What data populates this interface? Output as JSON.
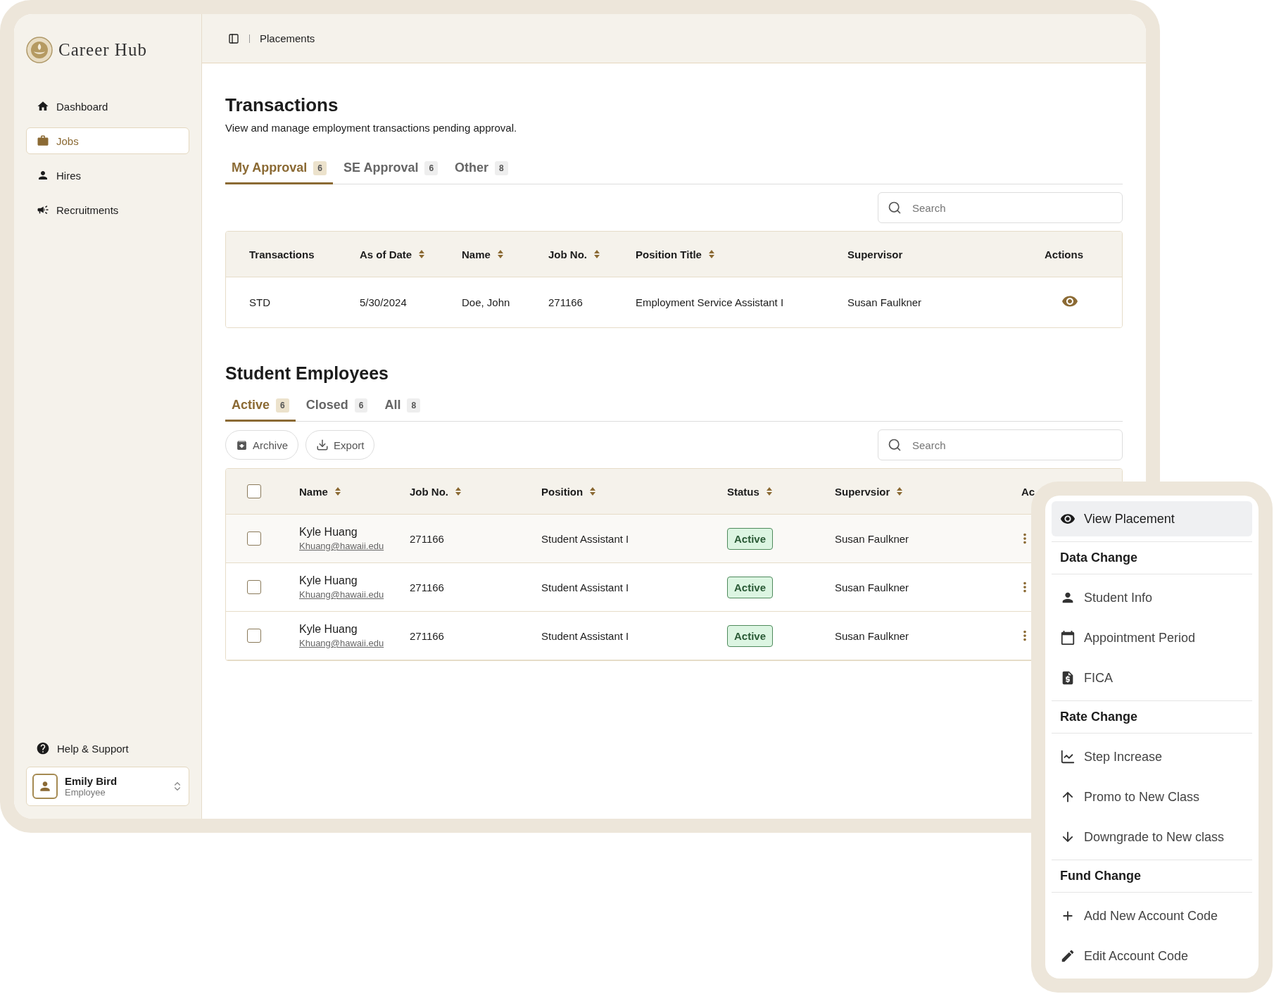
{
  "sidebar": {
    "logo": "Career Hub",
    "nav": [
      {
        "label": "Dashboard",
        "selected": false
      },
      {
        "label": "Jobs",
        "selected": true
      },
      {
        "label": "Hires",
        "selected": false
      },
      {
        "label": "Recruitments",
        "selected": false
      }
    ],
    "help": "Help & Support",
    "user": {
      "name": "Emily Bird",
      "role": "Employee"
    }
  },
  "header": {
    "breadcrumb": "Placements"
  },
  "transactions": {
    "title": "Transactions",
    "subtitle": "View and manage employment transactions pending approval.",
    "tabs": [
      {
        "label": "My Approval",
        "count": "6",
        "selected": true
      },
      {
        "label": "SE Approval",
        "count": "6",
        "selected": false
      },
      {
        "label": "Other",
        "count": "8",
        "selected": false
      }
    ],
    "search": {
      "placeholder": "Search"
    },
    "table": {
      "columns": [
        {
          "label": "Transactions",
          "sortable": false
        },
        {
          "label": "As of Date",
          "sortable": true
        },
        {
          "label": "Name",
          "sortable": true
        },
        {
          "label": "Job No.",
          "sortable": true
        },
        {
          "label": "Position Title",
          "sortable": true
        },
        {
          "label": "Supervisor",
          "sortable": false
        },
        {
          "label": "Actions",
          "sortable": false
        }
      ],
      "rows": [
        {
          "cells": [
            "STD",
            "5/30/2024",
            "Doe, John",
            "271166",
            "Employment Service Assistant I",
            "Susan Faulkner"
          ]
        }
      ]
    }
  },
  "student_employees": {
    "title": "Student Employees",
    "tabs": [
      {
        "label": "Active",
        "count": "6",
        "selected": true
      },
      {
        "label": "Closed",
        "count": "6",
        "selected": false
      },
      {
        "label": "All",
        "count": "8",
        "selected": false
      }
    ],
    "buttons": [
      {
        "kind": "archive",
        "label": "Archive"
      },
      {
        "kind": "export",
        "label": "Export"
      }
    ],
    "search": {
      "placeholder": "Search"
    },
    "table": {
      "select_all": {
        "checked": false
      },
      "columns": [
        {
          "label": "Name",
          "sortable": true
        },
        {
          "label": "Job No.",
          "sortable": true
        },
        {
          "label": "Position",
          "sortable": true
        },
        {
          "label": "Status",
          "sortable": true
        },
        {
          "label": "Supervsior",
          "sortable": true
        },
        {
          "label": "Ac"
        }
      ],
      "rows": [
        {
          "checked": false,
          "name": "Kyle Huang",
          "email": "Khuang@hawaii.edu",
          "job_no": "271166",
          "position": "Student Assistant I",
          "status": "Active",
          "supervisor": "Susan Faulkner"
        },
        {
          "checked": false,
          "name": "Kyle Huang",
          "email": "Khuang@hawaii.edu",
          "job_no": "271166",
          "position": "Student Assistant I",
          "status": "Active",
          "supervisor": "Susan Faulkner"
        },
        {
          "checked": false,
          "name": "Kyle Huang",
          "email": "Khuang@hawaii.edu",
          "job_no": "271166",
          "position": "Student Assistant I",
          "status": "Active",
          "supervisor": "Susan Faulkner"
        }
      ]
    }
  },
  "menu": {
    "top": {
      "label": "View Placement",
      "selected": true
    },
    "sections": [
      {
        "heading": "Data Change",
        "items": [
          {
            "label": "Student Info",
            "selected": false
          },
          {
            "label": "Appointment Period",
            "selected": false
          },
          {
            "label": "FICA",
            "selected": false
          }
        ]
      },
      {
        "heading": "Rate Change",
        "items": [
          {
            "label": "Step Increase",
            "selected": false
          },
          {
            "label": "Promo to New Class",
            "selected": false
          },
          {
            "label": "Downgrade to New class",
            "selected": false
          }
        ]
      },
      {
        "heading": "Fund Change",
        "items": [
          {
            "label": "Add New Account Code",
            "selected": false
          },
          {
            "label": "Edit Account Code",
            "selected": false
          }
        ]
      }
    ]
  }
}
